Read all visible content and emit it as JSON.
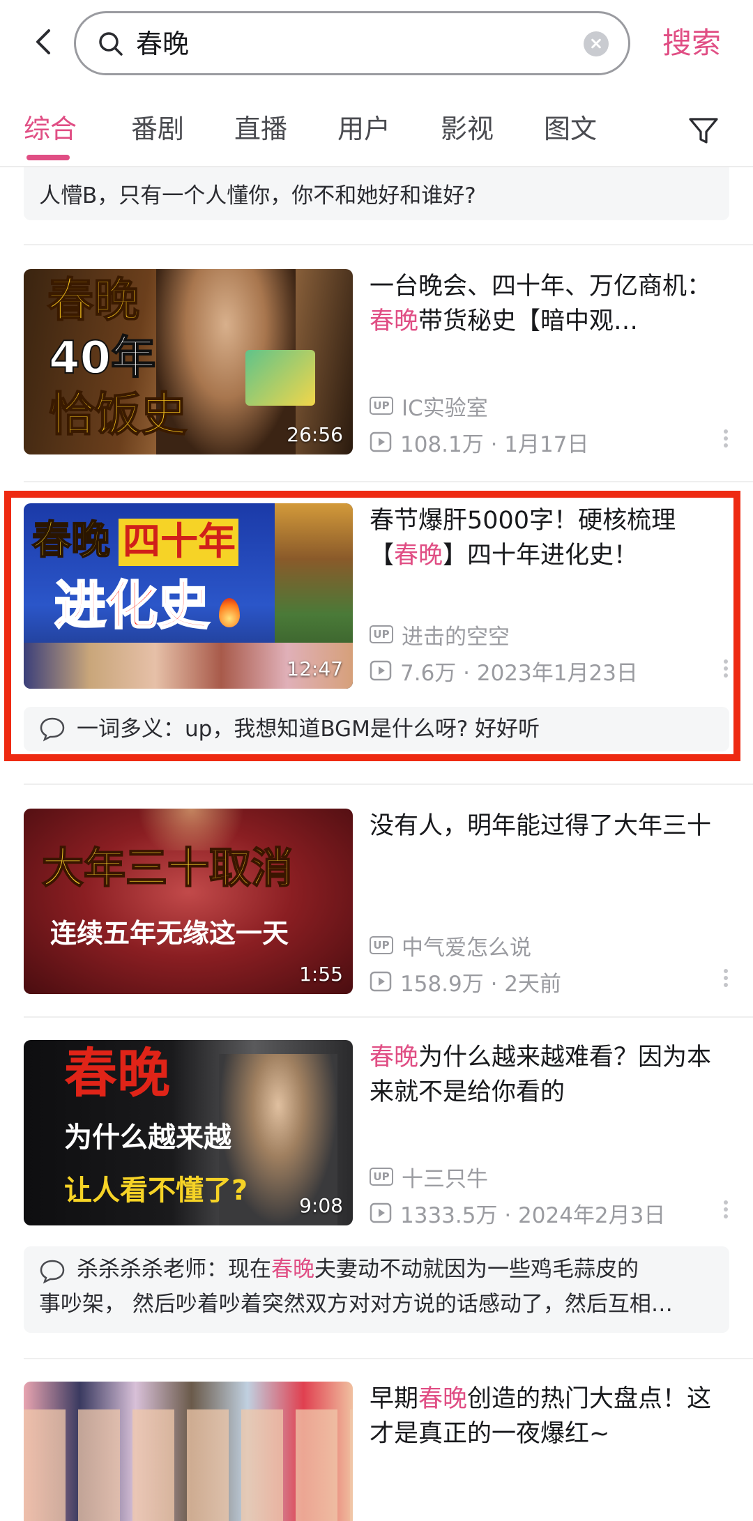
{
  "header": {
    "search_value": "春晚",
    "search_button": "搜索",
    "tabs": [
      "综合",
      "番剧",
      "直播",
      "用户",
      "影视",
      "图文"
    ]
  },
  "top_comment": {
    "text": "人懵B，只有一个人懂你，你不和她好和谁好?"
  },
  "videos": [
    {
      "thumb_lines": [
        "春晚",
        "40年",
        "恰饭史"
      ],
      "duration": "26:56",
      "title_hl": "",
      "title_prefix": "一台晚会、四十年、万亿商机：",
      "title_keyword": "春晚",
      "title_suffix": "带货秘史【暗中观…",
      "author": "IC实验室",
      "stats": "108.1万 · 1月17日"
    },
    {
      "thumb_lines": [
        "春晚",
        "四十年",
        "进化史"
      ],
      "duration": "12:47",
      "title_prefix": "春节爆肝5000字！硬核梳理【",
      "title_keyword": "春晚",
      "title_suffix": "】四十年进化史！",
      "author": "进击的空空",
      "stats": "7.6万 · 2023年1月23日",
      "comment": "一词多义：up，我想知道BGM是什么呀?  好好听"
    },
    {
      "thumb_lines": [
        "大年三十取消",
        "连续五年无缘这一天"
      ],
      "duration": "1:55",
      "title_prefix": "没有人，明年能过得了大年三十",
      "title_keyword": "",
      "title_suffix": "",
      "author": "中气爱怎么说",
      "stats": "158.9万 · 2天前"
    },
    {
      "thumb_lines": [
        "春晚",
        "为什么越来越",
        "让人看不懂了?"
      ],
      "duration": "9:08",
      "title_prefix": "",
      "title_keyword": "春晚",
      "title_suffix": "为什么越来越难看？因为本来就不是给你看的",
      "author": "十三只牛",
      "stats": "1333.5万 · 2024年2月3日",
      "comment_prefix": "杀杀杀杀老师：现在",
      "comment_keyword": "春晚",
      "comment_suffix": "夫妻动不动就因为一些鸡毛蒜皮的",
      "comment_line2": "事吵架，  然后吵着吵着突然双方对对方说的话感动了，然后互相…"
    },
    {
      "title_prefix": "早期",
      "title_keyword": "春晚",
      "title_suffix": "创造的热门大盘点！这才是真正的一夜爆红~"
    }
  ],
  "colors": {
    "accent": "#e04e84",
    "highlight_border": "#ee2a12"
  },
  "up_label": "UP"
}
